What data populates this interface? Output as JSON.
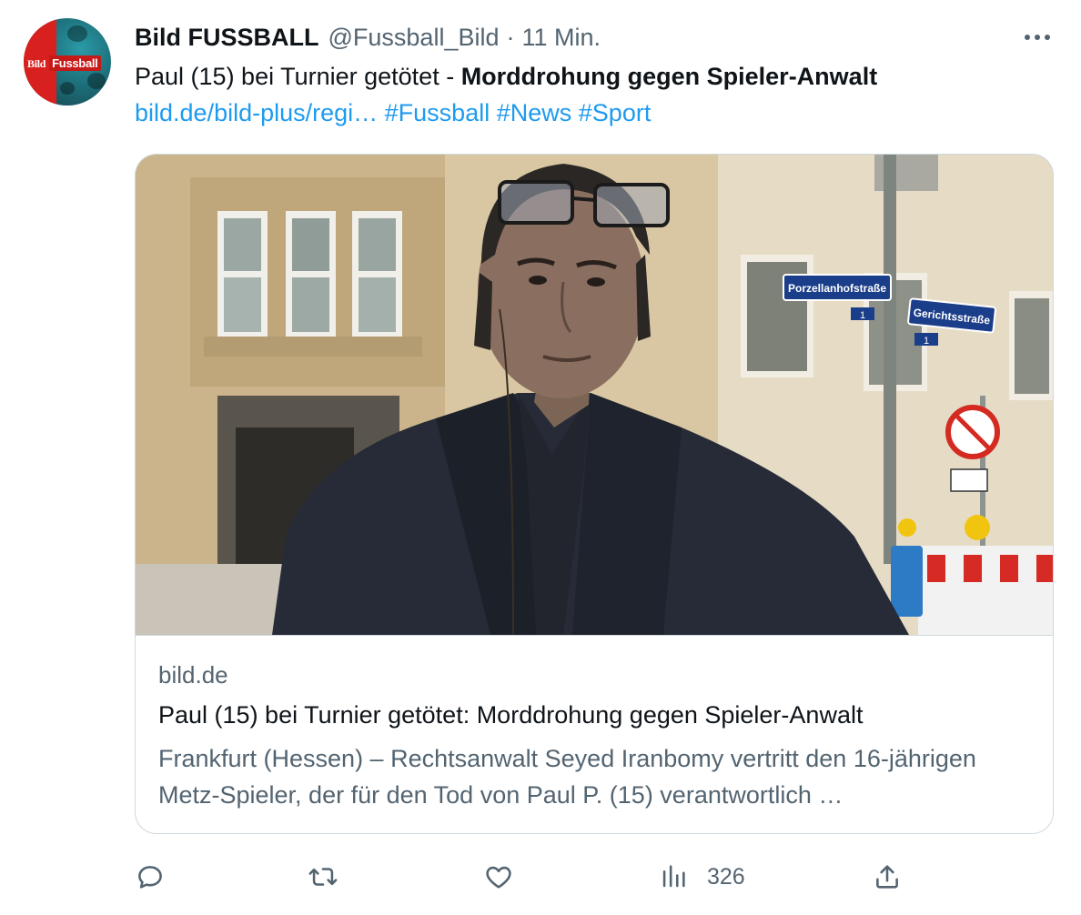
{
  "tweet": {
    "author_name": "Bild FUSSBALL",
    "handle": "@Fussball_Bild",
    "separator": "·",
    "time": "11 Min.",
    "avatar_logo": {
      "part1": "Bild",
      "part2": "Fussball"
    },
    "text_plain": "Paul (15) bei Turnier getötet - ",
    "text_bold": "Morddrohung gegen Spieler-Anwalt",
    "link_url": "bild.de/bild-plus/regi…",
    "hashtags": [
      "#Fussball",
      "#News",
      "#Sport"
    ]
  },
  "card": {
    "domain": "bild.de",
    "title": "Paul (15) bei Turnier getötet: Morddrohung gegen Spieler-Anwalt",
    "description": "Frankfurt (Hessen) – Rechtsanwalt Seyed Iranbomy vertritt den 16-jährigen Metz-Spieler, der für den Tod von Paul P. (15) verantwortlich …",
    "image_signs": {
      "sign1": "Porzellanhofstraße",
      "sign2": "Gerichtsstraße",
      "num1": "1",
      "num2": "1"
    }
  },
  "actions": {
    "reply_icon": "reply-icon",
    "retweet_icon": "retweet-icon",
    "like_icon": "like-icon",
    "views_icon": "views-icon",
    "views_count": "326",
    "share_icon": "share-icon"
  },
  "colors": {
    "link": "#1d9bf0",
    "secondary_text": "#536471",
    "border": "#cfd9de"
  }
}
